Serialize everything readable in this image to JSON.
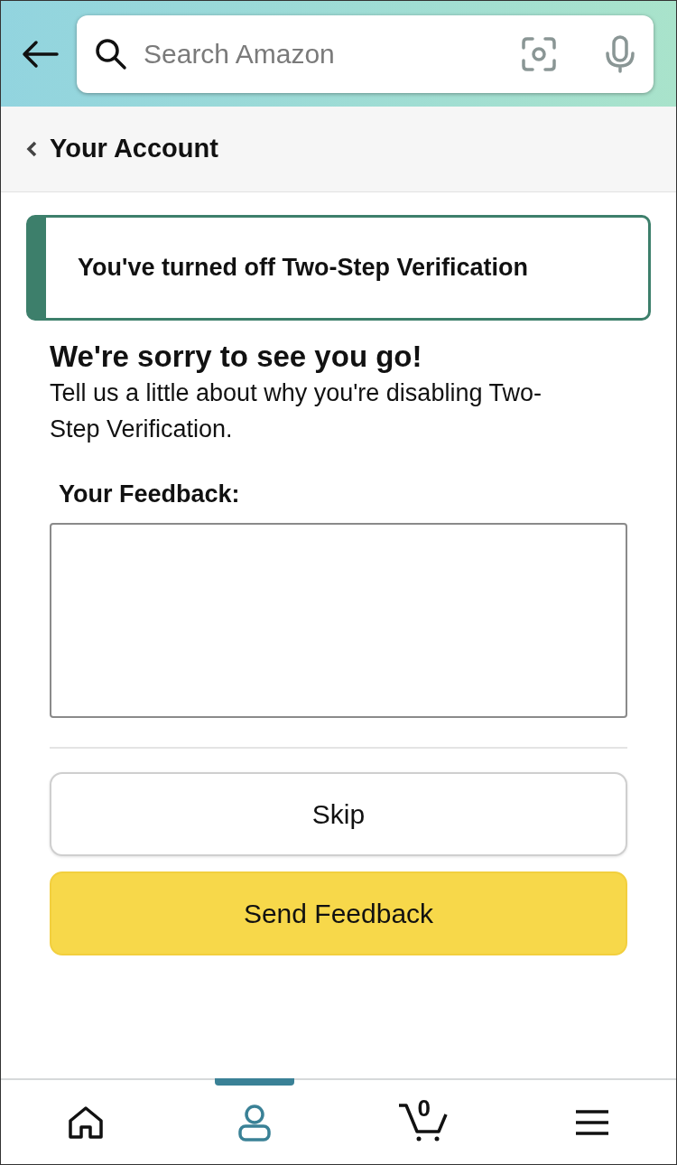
{
  "search": {
    "placeholder": "Search Amazon"
  },
  "breadcrumb": {
    "label": "Your Account"
  },
  "alert": {
    "message": "You've turned off Two-Step Verification"
  },
  "heading": "We're sorry to see you go!",
  "description": "Tell us a little about why you're disabling Two-Step Verification.",
  "feedback": {
    "label": "Your Feedback:"
  },
  "buttons": [
    {
      "label": "Skip",
      "kind": "secondary"
    },
    {
      "label": "Send Feedback",
      "kind": "primary"
    }
  ],
  "nav": [
    {
      "kind": "home",
      "selected": false
    },
    {
      "kind": "account",
      "selected": true
    },
    {
      "kind": "cart",
      "selected": false,
      "count": "0"
    },
    {
      "kind": "menu",
      "selected": false
    }
  ]
}
